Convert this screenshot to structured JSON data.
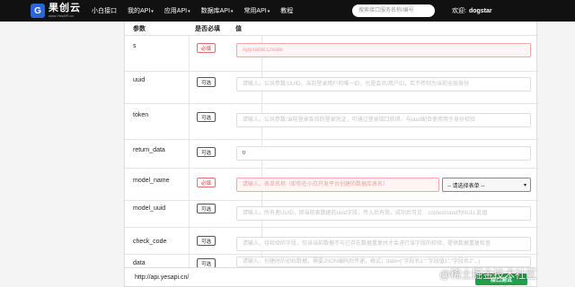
{
  "nav": {
    "logo_mark": "G",
    "logo_title": "果创云",
    "logo_subtitle": "www.YesAPI.cn",
    "links": [
      {
        "label": "小白接口"
      },
      {
        "label": "我的API",
        "caret": "▾"
      },
      {
        "label": "应用API",
        "caret": "▾"
      },
      {
        "label": "数据库API",
        "caret": "▾"
      },
      {
        "label": "常用API",
        "caret": "▾"
      },
      {
        "label": "教程"
      }
    ],
    "search_placeholder": "搜索接口服务名称/编号",
    "welcome_prefix": "欢迎:",
    "username": "dogstar"
  },
  "table": {
    "headers": {
      "param": "参数",
      "required": "是否必填",
      "value": "值"
    },
    "rows": [
      {
        "name": "s",
        "badge": "必填",
        "required": true,
        "value": "",
        "placeholder": "AppTable.Create",
        "error": true
      },
      {
        "name": "uuid",
        "badge": "可选",
        "required": false,
        "value": "",
        "placeholder": "请输入，公共参数:UUID，当前登录用户的唯一ID，也是会员/用户ID，若不传则为当前全局身份",
        "error": false
      },
      {
        "name": "token",
        "badge": "可选",
        "required": false,
        "value": "",
        "placeholder": "请输入，公共参数:当前登录会员的登录凭证，可通过登录接口获得，与uuid配合使用用于身份校验",
        "error": false
      },
      {
        "name": "return_data",
        "badge": "可选",
        "required": false,
        "value": "0",
        "placeholder": "",
        "error": false
      },
      {
        "name": "model_name",
        "badge": "必填",
        "required": true,
        "value": "",
        "placeholder": "请输入，表单名称（即你在小白开发平台创建的数据库表名）",
        "error": true,
        "select": "-- 请选择表单 --"
      },
      {
        "name": "model_uuid",
        "badge": "可选",
        "required": false,
        "value": "",
        "placeholder": "请输入，所有者UUID，即当前表数据的uuid字段，传入后有效，成功后可见    context/uuid为NULL此值",
        "error": false
      },
      {
        "name": "check_code",
        "badge": "可选",
        "required": false,
        "value": "",
        "placeholder": "请输入，待检验的字段，仅当当前数据不与已存在数据重复时才会进行该字段的校验，提供数据重复检查",
        "error": false
      },
      {
        "name": "data",
        "badge": "可选",
        "required": false,
        "value": "",
        "placeholder": "请输入，创建时的初始数据，需要JSON编码后传递，格式：data={\"字段名1\":\"字段值1\",\"字段名2\"...}",
        "error": false
      }
    ]
  },
  "request": {
    "url": "http://api.yesapi.cn/",
    "submit_label": "接口测试"
  },
  "watermark": "@稀土掘金技术社区"
}
